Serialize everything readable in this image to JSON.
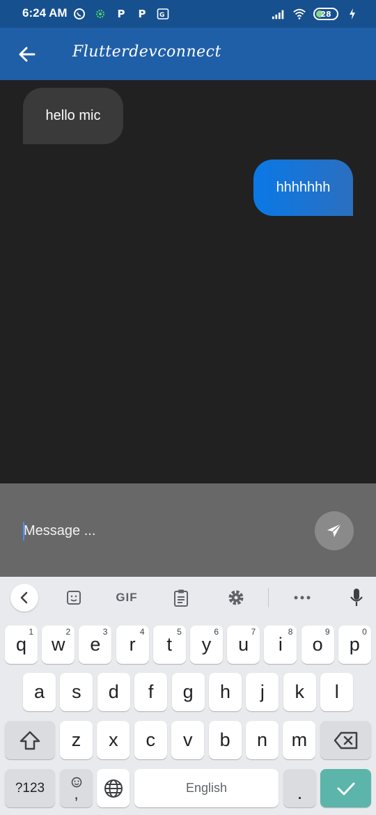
{
  "status_bar": {
    "time": "6:24 AM",
    "battery_level": "28",
    "left_icons": [
      "whatsapp-icon",
      "gear-app-icon",
      "p-icon",
      "p-icon",
      "translate-icon"
    ],
    "right_icons": [
      "signal-icon",
      "wifi-icon",
      "battery-icon",
      "charging-icon"
    ]
  },
  "app_bar": {
    "title": "Flutterdevconnect",
    "back_icon": "back-arrow-icon"
  },
  "messages": [
    {
      "direction": "incoming",
      "text": "hello mic"
    },
    {
      "direction": "outgoing",
      "text": "hhhhhhh"
    }
  ],
  "composer": {
    "placeholder": "Message ...",
    "value": "",
    "send_icon": "send-icon"
  },
  "keyboard": {
    "toolbar": {
      "gif_label": "GIF",
      "icons": [
        "chevron-left-icon",
        "sticker-icon",
        "clipboard-icon",
        "settings-icon",
        "more-icon",
        "microphone-icon"
      ]
    },
    "row1": [
      {
        "label": "q",
        "hint": "1"
      },
      {
        "label": "w",
        "hint": "2"
      },
      {
        "label": "e",
        "hint": "3"
      },
      {
        "label": "r",
        "hint": "4"
      },
      {
        "label": "t",
        "hint": "5"
      },
      {
        "label": "y",
        "hint": "6"
      },
      {
        "label": "u",
        "hint": "7"
      },
      {
        "label": "i",
        "hint": "8"
      },
      {
        "label": "o",
        "hint": "9"
      },
      {
        "label": "p",
        "hint": "0"
      }
    ],
    "row2": [
      "a",
      "s",
      "d",
      "f",
      "g",
      "h",
      "j",
      "k",
      "l"
    ],
    "row3": [
      "z",
      "x",
      "c",
      "v",
      "b",
      "n",
      "m"
    ],
    "symbols_label": "?123",
    "comma_label": ",",
    "space_label": "English",
    "period_label": ".",
    "accent_color": "#5bb5aa"
  },
  "colors": {
    "status_bar": "#17508f",
    "app_bar": "#1f5fa8",
    "chat_background": "#212121",
    "incoming_bubble": "#3a3a3a",
    "outgoing_bubble": "#0a78e6",
    "composer_background": "#686868"
  }
}
